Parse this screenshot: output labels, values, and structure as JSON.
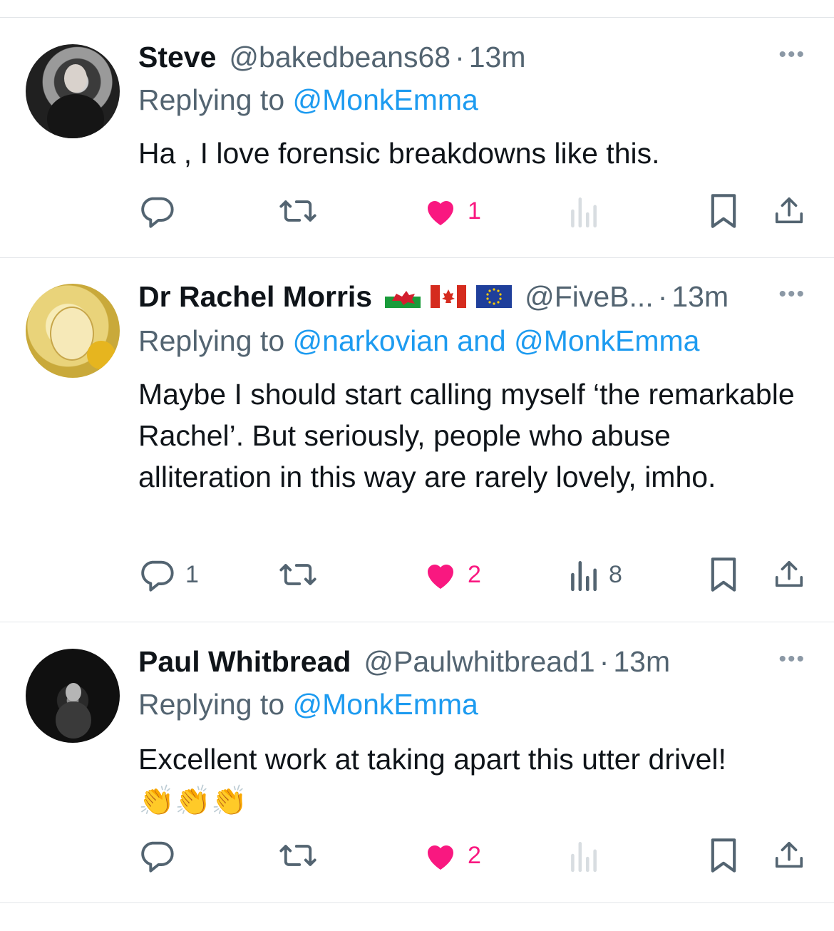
{
  "tweets": [
    {
      "name": "Steve",
      "handle": "@bakedbeans68",
      "dot": "·",
      "time": "13m",
      "reply_prefix": "Replying to ",
      "reply_to": "@MonkEmma",
      "text": "Ha , I love forensic breakdowns like this.",
      "more": "•••",
      "actions": {
        "replies": "",
        "reposts": "",
        "likes": "1",
        "liked": true,
        "views": "",
        "views_dim": true
      }
    },
    {
      "name": "Dr Rachel Morris",
      "flags": [
        "wales-flag-icon",
        "canada-flag-icon",
        "eu-flag-icon"
      ],
      "handle": "@FiveB...",
      "dot": "·",
      "time": "13m",
      "reply_prefix": "Replying to ",
      "reply_to": "@narkovian and @MonkEmma",
      "text": "Maybe I should start calling myself ‘the remarkable Rachel’. But seriously, people who abuse alliteration in this way are rarely lovely, imho.",
      "more": "•••",
      "actions": {
        "replies": "1",
        "reposts": "",
        "likes": "2",
        "liked": true,
        "views": "8",
        "views_dim": false
      }
    },
    {
      "name": "Paul Whitbread",
      "handle": "@Paulwhitbread1",
      "dot": "·",
      "time": "13m",
      "reply_prefix": "Replying to ",
      "reply_to": "@MonkEmma",
      "text": "Excellent work at taking apart this utter drivel!",
      "emoji": "👏👏👏",
      "more": "•••",
      "actions": {
        "replies": "",
        "reposts": "",
        "likes": "2",
        "liked": true,
        "views": "",
        "views_dim": true
      }
    }
  ],
  "colors": {
    "like": "#f91880",
    "link": "#1d9bf0",
    "muted": "#536471",
    "text": "#0f1419"
  }
}
